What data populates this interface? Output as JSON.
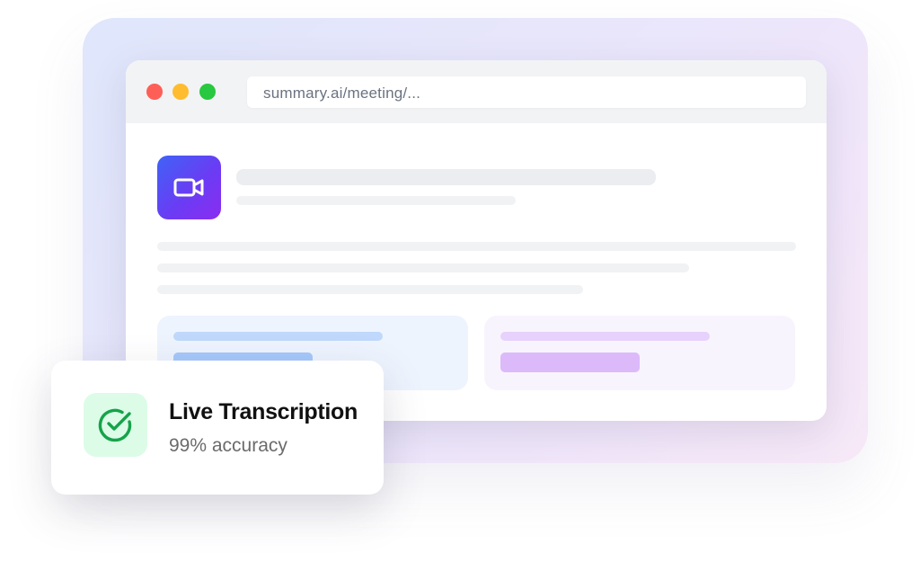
{
  "browser": {
    "url": "summary.ai/meeting/...",
    "window_controls": [
      {
        "name": "close",
        "color": "#fd5f57"
      },
      {
        "name": "minimize",
        "color": "#febc2e"
      },
      {
        "name": "maximize",
        "color": "#28c840"
      }
    ]
  },
  "content": {
    "app_icon": "video-camera-icon",
    "skeleton_color": "#ebedf0",
    "cards": [
      {
        "tone": "blue",
        "bg": "#eef4fe",
        "line_color": "#bfd8fb",
        "bar_color": "#a6c8fa"
      },
      {
        "tone": "purple",
        "bg": "#f8f4fe",
        "line_color": "#e6d2fc",
        "bar_color": "#dcbafa"
      }
    ]
  },
  "notification": {
    "icon": "check-circle-icon",
    "title": "Live Transcription",
    "subtitle": "99% accuracy",
    "accent": "#16a34a"
  }
}
